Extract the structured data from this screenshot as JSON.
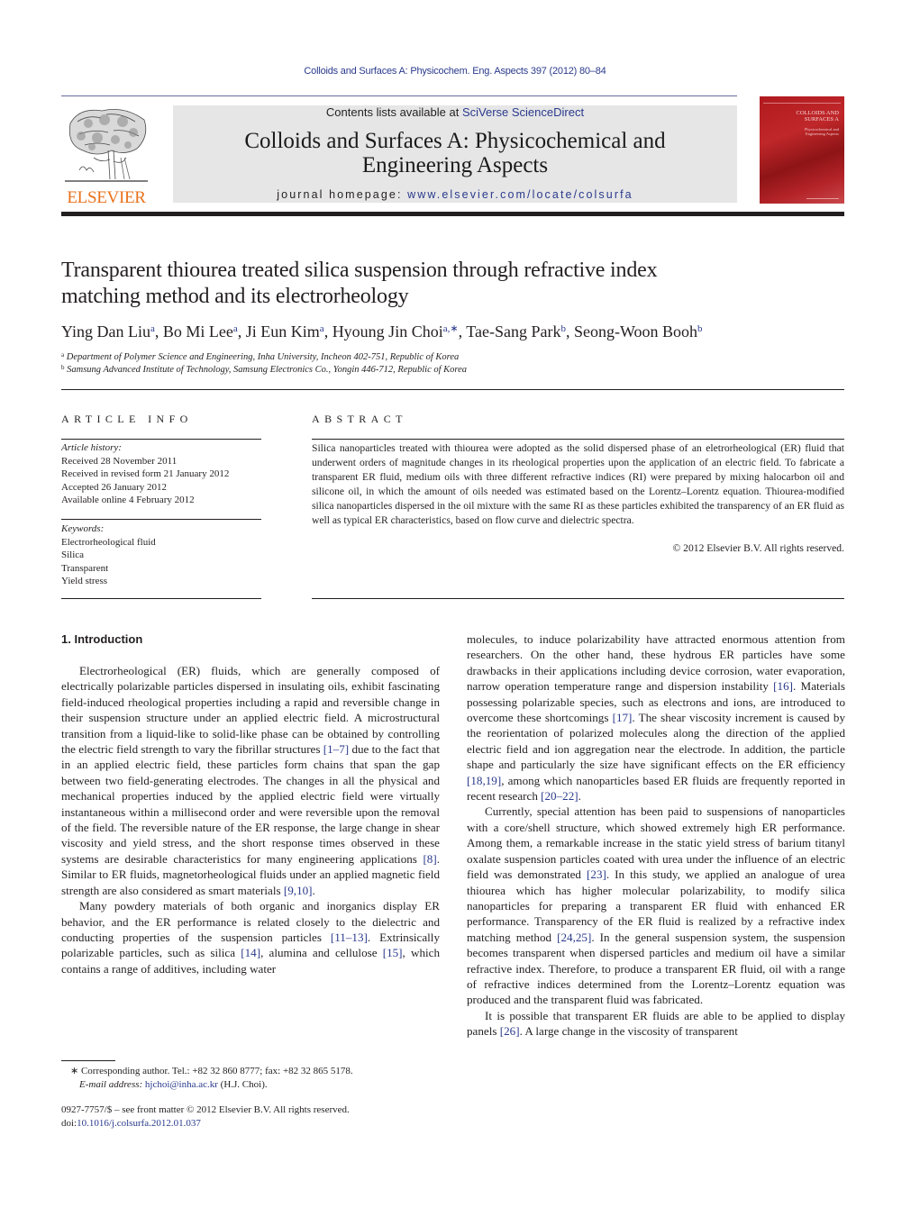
{
  "running_header": "Colloids and Surfaces A: Physicochem. Eng. Aspects 397 (2012) 80–84",
  "publisher": {
    "logo_word": "ELSEVIER",
    "brand_color": "#e9711c"
  },
  "banner": {
    "contents_prefix": "Contents lists available at ",
    "contents_link": "SciVerse ScienceDirect",
    "journal_title_line1": "Colloids and Surfaces A: Physicochemical and",
    "journal_title_line2": "Engineering Aspects",
    "homepage_prefix": "journal homepage: ",
    "homepage_link": "www.elsevier.com/locate/colsurfa"
  },
  "cover": {
    "title_line1": "COLLOIDS AND",
    "title_line2": "SURFACES A",
    "subtitle_line1": "Physicochemical and",
    "subtitle_line2": "Engineering Aspects",
    "color": "#b01a1e"
  },
  "article": {
    "title_line1": "Transparent thiourea treated silica suspension through refractive index",
    "title_line2": "matching method and its electrorheology",
    "authors": [
      {
        "name": "Ying Dan Liu",
        "sup": "a"
      },
      {
        "name": "Bo Mi Lee",
        "sup": "a"
      },
      {
        "name": "Ji Eun Kim",
        "sup": "a"
      },
      {
        "name": "Hyoung Jin Choi",
        "sup": "a,∗"
      },
      {
        "name": "Tae-Sang Park",
        "sup": "b"
      },
      {
        "name": "Seong-Woon Booh",
        "sup": "b"
      }
    ],
    "affiliations": [
      {
        "sup": "a",
        "text": "Department of Polymer Science and Engineering, Inha University, Incheon 402-751, Republic of Korea"
      },
      {
        "sup": "b",
        "text": "Samsung Advanced Institute of Technology, Samsung Electronics Co., Yongin 446-712, Republic of Korea"
      }
    ]
  },
  "article_info": {
    "heading": "ARTICLE INFO",
    "history_label": "Article history:",
    "history": [
      "Received 28 November 2011",
      "Received in revised form 21 January 2012",
      "Accepted 26 January 2012",
      "Available online 4 February 2012"
    ],
    "keywords_label": "Keywords:",
    "keywords": [
      "Electrorheological fluid",
      "Silica",
      "Transparent",
      "Yield stress"
    ]
  },
  "abstract": {
    "heading": "ABSTRACT",
    "text": "Silica nanoparticles treated with thiourea were adopted as the solid dispersed phase of an eletrorheological (ER) fluid that underwent orders of magnitude changes in its rheological properties upon the application of an electric field. To fabricate a transparent ER fluid, medium oils with three different refractive indices (RI) were prepared by mixing halocarbon oil and silicone oil, in which the amount of oils needed was estimated based on the Lorentz–Lorentz equation. Thiourea-modified silica nanoparticles dispersed in the oil mixture with the same RI as these particles exhibited the transparency of an ER fluid as well as typical ER characteristics, based on flow curve and dielectric spectra.",
    "copyright": "© 2012 Elsevier B.V. All rights reserved."
  },
  "body": {
    "section_heading": "1.  Introduction",
    "left_column": [
      {
        "indent": true,
        "segments": [
          {
            "t": "Electrorheological (ER) fluids, which are generally composed of electrically polarizable particles dispersed in insulating oils, exhibit fascinating field-induced rheological properties including a rapid and reversible change in their suspension structure under an applied electric field. A microstructural transition from a liquid-like to solid-like phase can be obtained by controlling the electric field strength to vary the fibrillar structures "
          },
          {
            "t": "[1–7]",
            "ref": true
          },
          {
            "t": " due to the fact that in an applied electric field, these particles form chains that span the gap between two field-generating electrodes. The changes in all the physical and mechanical properties induced by the applied electric field were virtually instantaneous within a millisecond order and were reversible upon the removal of the field. The reversible nature of the ER response, the large change in shear viscosity and yield stress, and the short response times observed in these systems are desirable characteristics for many engineering applications "
          },
          {
            "t": "[8]",
            "ref": true
          },
          {
            "t": ". Similar to ER fluids, magnetorheological fluids under an applied magnetic field strength are also considered as smart materials "
          },
          {
            "t": "[9,10]",
            "ref": true
          },
          {
            "t": "."
          }
        ]
      },
      {
        "indent": true,
        "segments": [
          {
            "t": "Many powdery materials of both organic and inorganics display ER behavior, and the ER performance is related closely to the dielectric and conducting properties of the suspension particles "
          },
          {
            "t": "[11–13]",
            "ref": true
          },
          {
            "t": ". Extrinsically polarizable particles, such as silica "
          },
          {
            "t": "[14]",
            "ref": true
          },
          {
            "t": ", alumina and cellulose "
          },
          {
            "t": "[15]",
            "ref": true
          },
          {
            "t": ", which contains a range of additives, including water"
          }
        ]
      }
    ],
    "right_column": [
      {
        "indent": false,
        "segments": [
          {
            "t": "molecules, to induce polarizability have attracted enormous attention from researchers. On the other hand, these hydrous ER particles have some drawbacks in their applications including device corrosion, water evaporation, narrow operation temperature range and dispersion instability "
          },
          {
            "t": "[16]",
            "ref": true
          },
          {
            "t": ". Materials possessing polarizable species, such as electrons and ions, are introduced to overcome these shortcomings "
          },
          {
            "t": "[17]",
            "ref": true
          },
          {
            "t": ". The shear viscosity increment is caused by the reorientation of polarized molecules along the direction of the applied electric field and ion aggregation near the electrode. In addition, the particle shape and particularly the size have significant effects on the ER efficiency "
          },
          {
            "t": "[18,19]",
            "ref": true
          },
          {
            "t": ", among which nanoparticles based ER fluids are frequently reported in recent research "
          },
          {
            "t": "[20–22]",
            "ref": true
          },
          {
            "t": "."
          }
        ]
      },
      {
        "indent": true,
        "segments": [
          {
            "t": "Currently, special attention has been paid to suspensions of nanoparticles with a core/shell structure, which showed extremely high ER performance. Among them, a remarkable increase in the static yield stress of barium titanyl oxalate suspension particles coated with urea under the influence of an electric field was demonstrated "
          },
          {
            "t": "[23]",
            "ref": true
          },
          {
            "t": ". In this study, we applied an analogue of urea thiourea which has higher molecular polarizability, to modify silica nanoparticles for preparing a transparent ER fluid with enhanced ER performance. Transparency of the ER fluid is realized by a refractive index matching method "
          },
          {
            "t": "[24,25]",
            "ref": true
          },
          {
            "t": ". In the general suspension system, the suspension becomes transparent when dispersed particles and medium oil have a similar refractive index. Therefore, to produce a transparent ER fluid, oil with a range of refractive indices determined from the Lorentz–Lorentz equation was produced and the transparent fluid was fabricated."
          }
        ]
      },
      {
        "indent": true,
        "segments": [
          {
            "t": "It is possible that transparent ER fluids are able to be applied to display panels "
          },
          {
            "t": "[26]",
            "ref": true
          },
          {
            "t": ". A large change in the viscosity of transparent"
          }
        ]
      }
    ]
  },
  "footnote": {
    "marker": "∗",
    "corresponding": " Corresponding author. Tel.: +82 32 860 8777; fax: +82 32 865 5178.",
    "email_label": "E-mail address: ",
    "email": "hjchoi@inha.ac.kr",
    "email_suffix": " (H.J. Choi)."
  },
  "front_matter": {
    "issn_line": "0927-7757/$ – see front matter © 2012 Elsevier B.V. All rights reserved.",
    "doi_prefix": "doi:",
    "doi": "10.1016/j.colsurfa.2012.01.037"
  },
  "link_color": "#2a3a8c"
}
